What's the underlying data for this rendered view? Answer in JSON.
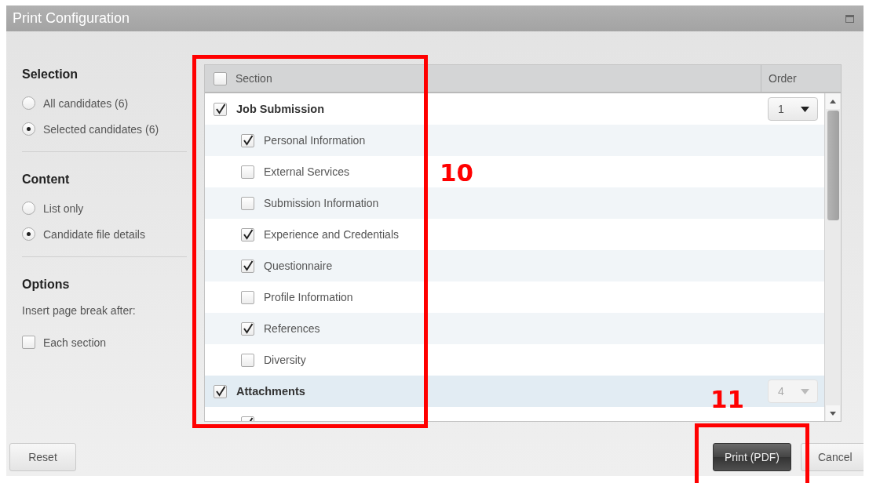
{
  "window": {
    "title": "Print Configuration"
  },
  "sidebar": {
    "groups": [
      {
        "heading": "Selection",
        "options": [
          {
            "label": "All candidates (6)",
            "selected": false
          },
          {
            "label": "Selected candidates (6)",
            "selected": true
          }
        ]
      },
      {
        "heading": "Content",
        "options": [
          {
            "label": "List only",
            "selected": false
          },
          {
            "label": "Candidate file details",
            "selected": true
          }
        ]
      },
      {
        "heading": "Options",
        "note": "Insert page break after:",
        "checkbox": {
          "label": "Each section",
          "checked": false
        }
      }
    ]
  },
  "table": {
    "header_checked": false,
    "columns": [
      "Section",
      "Order"
    ],
    "rows": [
      {
        "label": "Job Submission",
        "checked": true,
        "selected": false,
        "order": "1",
        "order_disabled": false,
        "children": [
          {
            "label": "Personal Information",
            "checked": true
          },
          {
            "label": "External Services",
            "checked": false
          },
          {
            "label": "Submission Information",
            "checked": false
          },
          {
            "label": "Experience and Credentials",
            "checked": true
          },
          {
            "label": "Questionnaire",
            "checked": true
          },
          {
            "label": "Profile Information",
            "checked": false
          },
          {
            "label": "References",
            "checked": true
          },
          {
            "label": "Diversity",
            "checked": false
          }
        ]
      },
      {
        "label": "Attachments",
        "checked": true,
        "selected": true,
        "order": "4",
        "order_disabled": true,
        "children": [
          {
            "checked": true
          }
        ]
      }
    ]
  },
  "footer": {
    "buttons": [
      {
        "label": "Reset",
        "kind": "plain"
      },
      {
        "label": "Print (PDF)",
        "kind": "primary"
      },
      {
        "label": "Cancel",
        "kind": "plain"
      }
    ]
  },
  "annotations": [
    {
      "label": "10"
    },
    {
      "label": "11"
    }
  ]
}
